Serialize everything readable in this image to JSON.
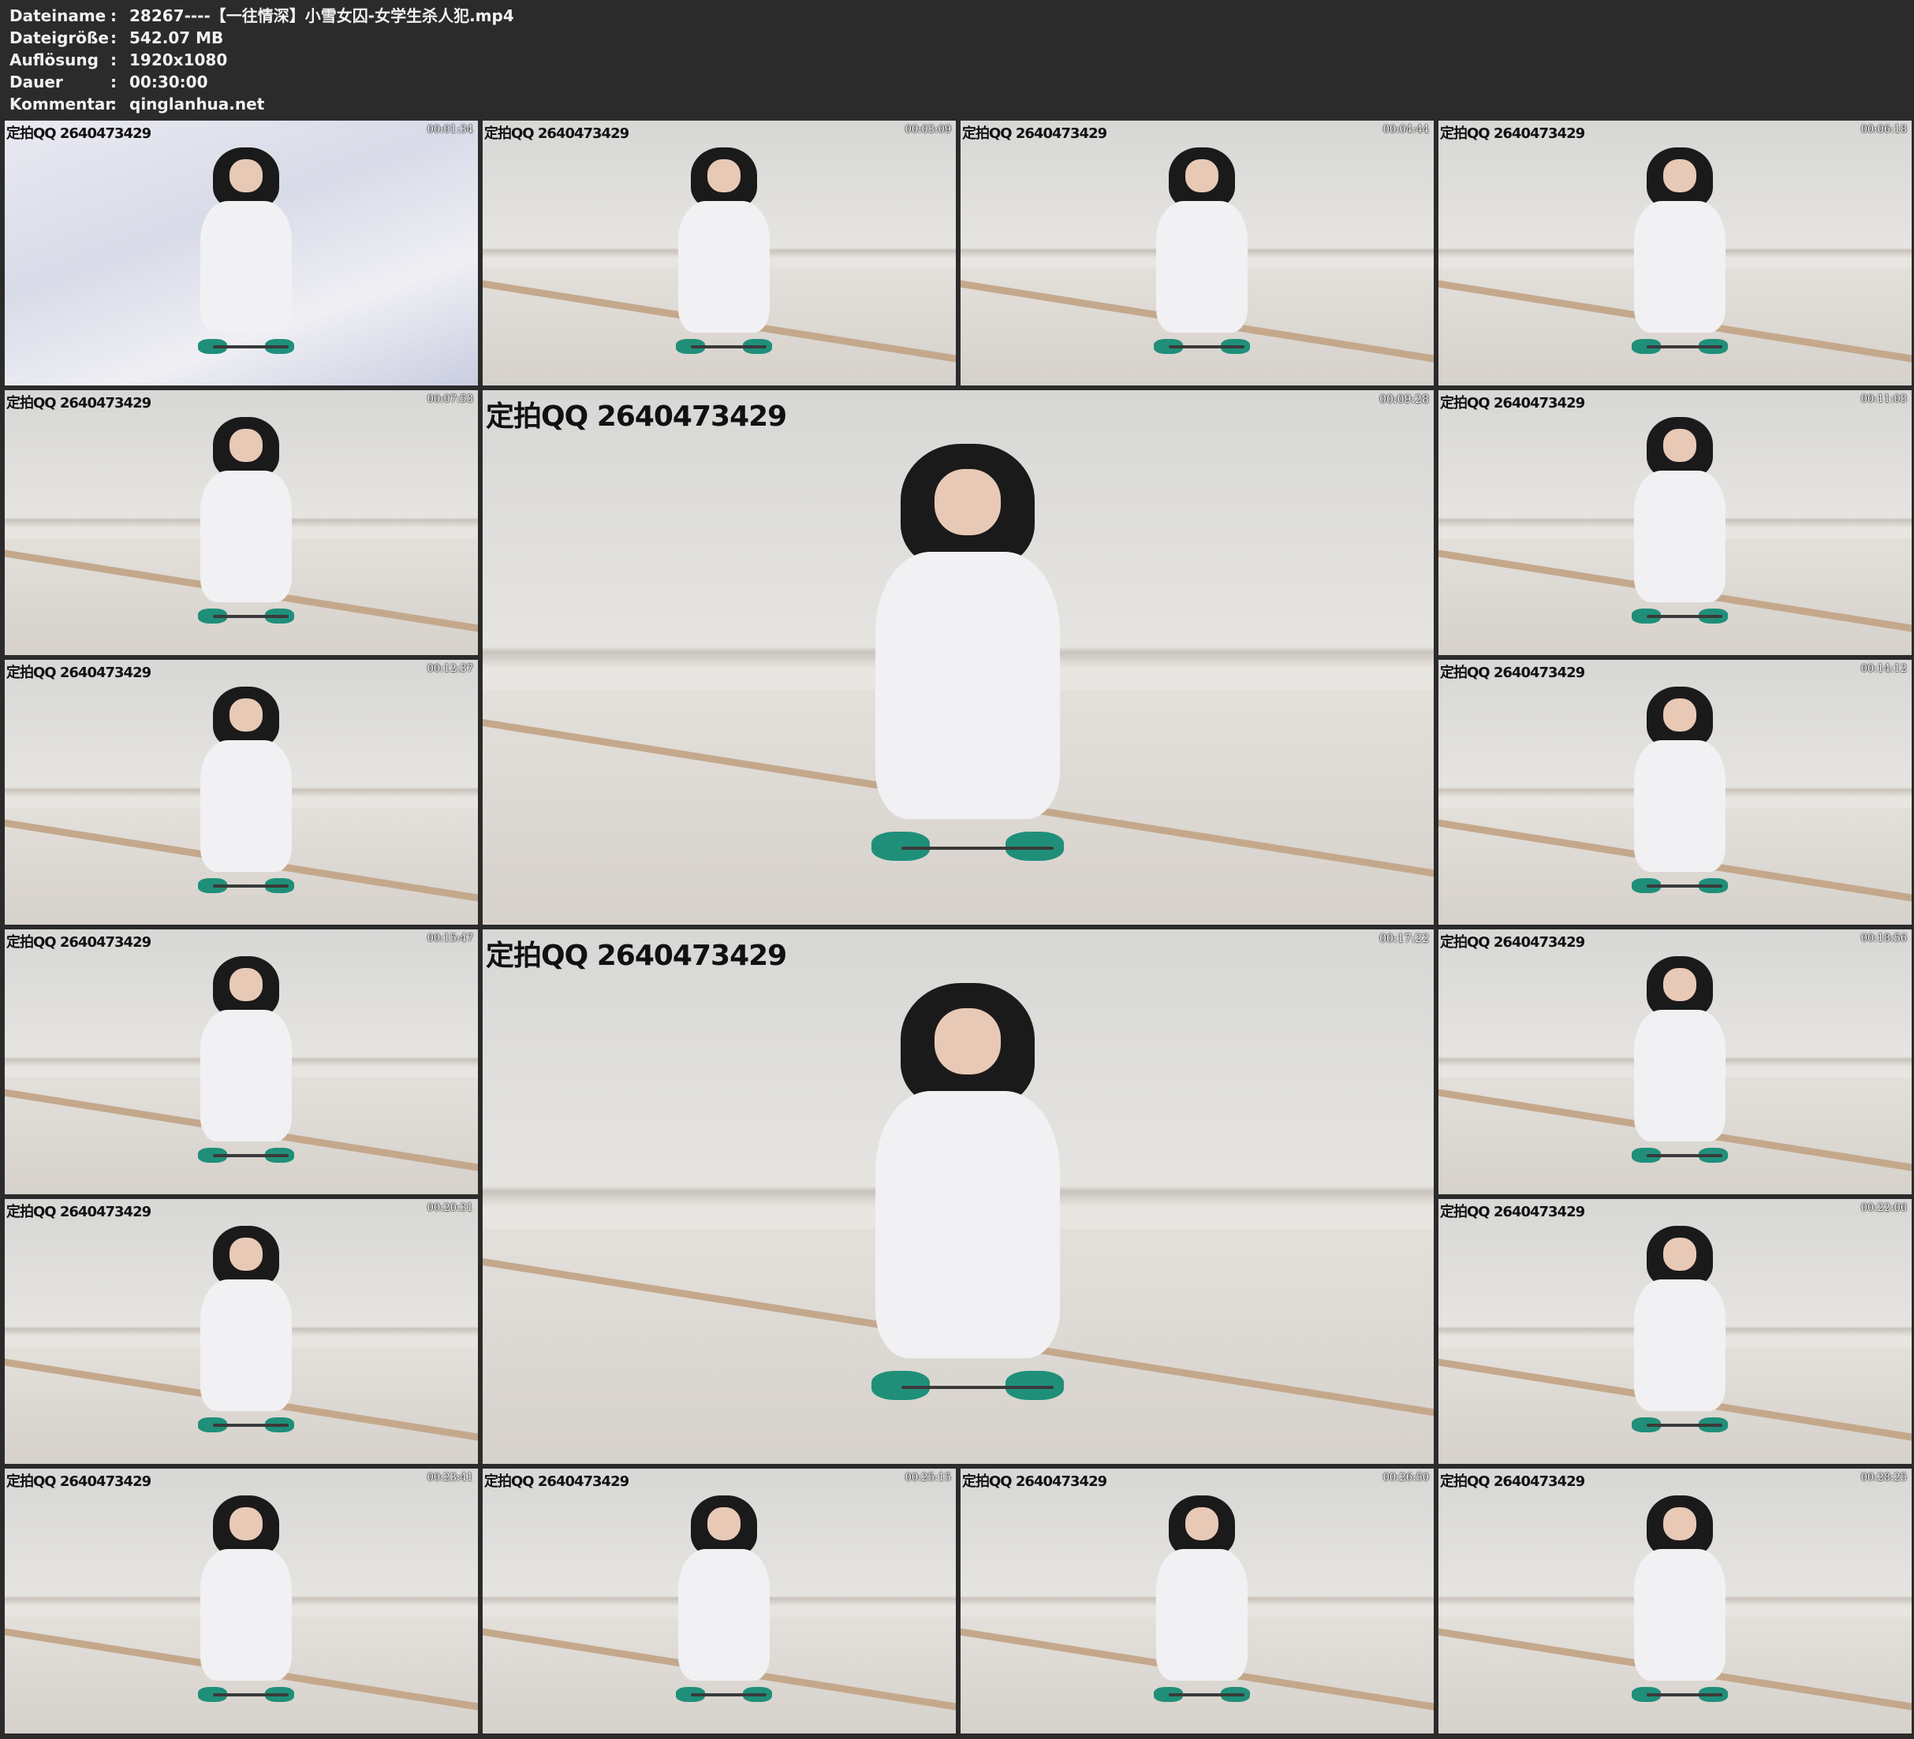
{
  "meta": [
    {
      "key": "Dateiname",
      "sep": ":",
      "value": "28267----【一往情深】小雪女囚-女学生杀人犯.mp4"
    },
    {
      "key": "Dateigröße",
      "sep": ":",
      "value": "542.07 MB"
    },
    {
      "key": "Auflösung",
      "sep": ":",
      "value": "1920x1080"
    },
    {
      "key": "Dauer",
      "sep": ":",
      "value": "00:30:00"
    },
    {
      "key": "Kommentar",
      "sep": ":",
      "value": "qinglanhua.net"
    }
  ],
  "watermark": "定拍QQ 2640473429",
  "thumbnails": [
    {
      "timestamp": "00:01:34",
      "watermark": "定拍QQ 2640473429",
      "scene": "bed"
    },
    {
      "timestamp": "00:03:09",
      "watermark": "定拍QQ 2640473429",
      "scene": "wall"
    },
    {
      "timestamp": "00:04:44",
      "watermark": "定拍QQ 2640473429",
      "scene": "wall"
    },
    {
      "timestamp": "00:06:18",
      "watermark": "定拍QQ 2640473429",
      "scene": "wall"
    },
    {
      "timestamp": "00:07:53",
      "watermark": "定拍QQ 2640473429",
      "scene": "wall"
    },
    {
      "timestamp": "00:09:28",
      "watermark": "定拍QQ 2640473429",
      "scene": "wall"
    },
    {
      "timestamp": "00:11:03",
      "watermark": "定拍QQ 2640473429",
      "scene": "wall"
    },
    {
      "timestamp": "00:12:37",
      "watermark": "定拍QQ 2640473429",
      "scene": "wall"
    },
    {
      "timestamp": "00:14:12",
      "watermark": "定拍QQ 2640473429",
      "scene": "wall"
    },
    {
      "timestamp": "00:15:47",
      "watermark": "定拍QQ 2640473429",
      "scene": "wall"
    },
    {
      "timestamp": "00:17:22",
      "watermark": "定拍QQ 2640473429",
      "scene": "wall"
    },
    {
      "timestamp": "00:18:56",
      "watermark": "定拍QQ 2640473429",
      "scene": "wall"
    },
    {
      "timestamp": "00:20:31",
      "watermark": "定拍QQ 2640473429",
      "scene": "wall"
    },
    {
      "timestamp": "00:22:06",
      "watermark": "定拍QQ 2640473429",
      "scene": "wall"
    },
    {
      "timestamp": "00:23:41",
      "watermark": "定拍QQ 2640473429",
      "scene": "wall"
    },
    {
      "timestamp": "00:25:15",
      "watermark": "定拍QQ 2640473429",
      "scene": "wall"
    },
    {
      "timestamp": "00:26:50",
      "watermark": "定拍QQ 2640473429",
      "scene": "wall"
    },
    {
      "timestamp": "00:28:25",
      "watermark": "定拍QQ 2640473429",
      "scene": "wall"
    }
  ]
}
